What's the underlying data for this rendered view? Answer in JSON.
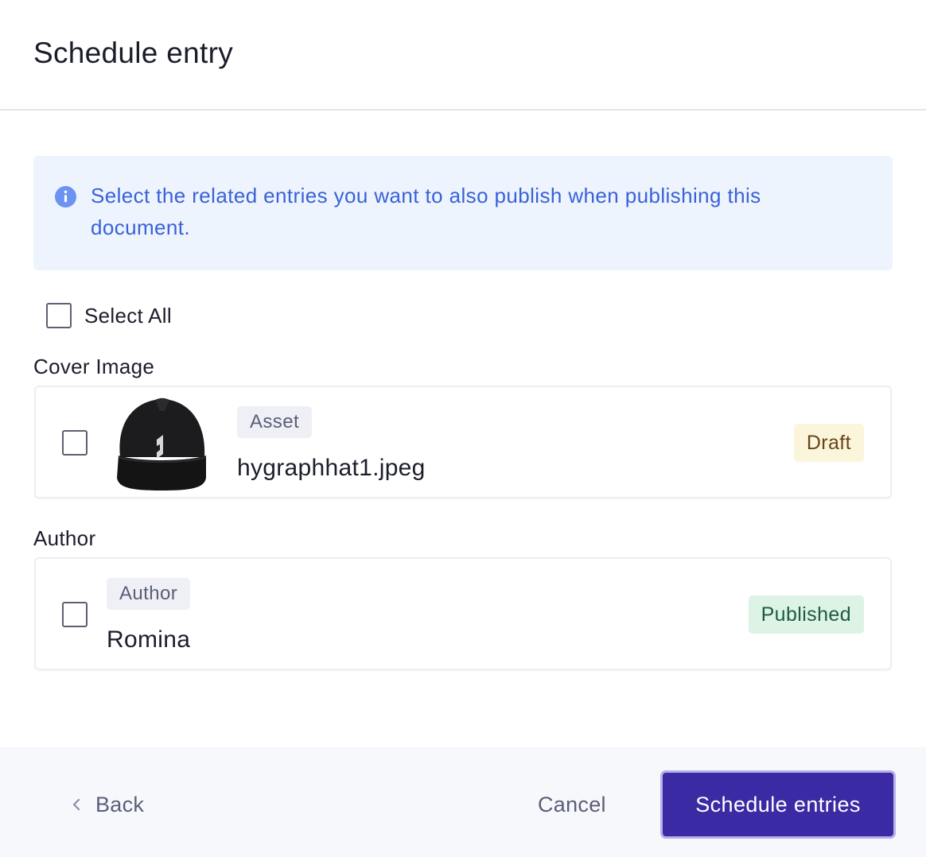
{
  "dialog": {
    "title": "Schedule entry"
  },
  "info": {
    "text": "Select the related entries you want to also publish when publishing this document.",
    "icon": "info-icon",
    "color": "#3a61d9"
  },
  "select_all": {
    "label": "Select All",
    "checked": false
  },
  "sections": [
    {
      "label": "Cover Image",
      "entry": {
        "type": "Asset",
        "title": "hygraphhat1.jpeg",
        "status": "Draft",
        "thumbnail": "black-snapback-hat-image"
      }
    },
    {
      "label": "Author",
      "entry": {
        "type": "Author",
        "title": "Romina",
        "status": "Published"
      }
    }
  ],
  "footer": {
    "back_label": "Back",
    "cancel_label": "Cancel",
    "primary_label": "Schedule entries"
  },
  "colors": {
    "primary": "#3a2aa3",
    "draft_bg": "#fbf5dc",
    "published_bg": "#dcf3e6"
  }
}
